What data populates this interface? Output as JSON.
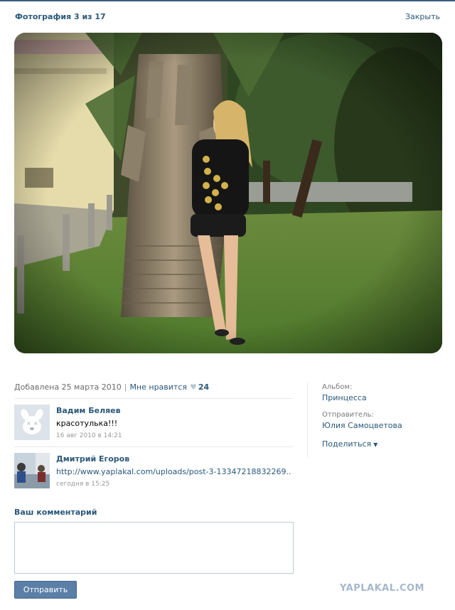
{
  "header": {
    "photo_title": "Фотография 3 из 17",
    "close_label": "Закрыть"
  },
  "photo": {
    "description": ""
  },
  "meta": {
    "added": "Добавлена 25 марта 2010",
    "separator": "|",
    "like_label": "Мне нравится",
    "like_count": "24"
  },
  "comments": [
    {
      "author": "Вадим Беляев",
      "text": "красотулька!!!",
      "date": "16 авг 2010 в 14:21",
      "avatar": "default-dog-avatar"
    },
    {
      "author": "Дмитрий Егоров",
      "text": "http://www.yaplakal.com/uploads/post-3-13347218832269..",
      "date": "сегодня в 15:25",
      "avatar": "user-photo-avatar"
    }
  ],
  "sidebar": {
    "album_label": "Альбом:",
    "album_value": "Принцесса",
    "sender_label": "Отправитель:",
    "sender_value": "Юлия Самоцветова",
    "share_label": "Поделиться"
  },
  "comment_form": {
    "label": "Ваш комментарий",
    "placeholder": "",
    "send_label": "Отправить"
  },
  "watermark": "YAPLAKAL.COM",
  "colors": {
    "link": "#2b587a",
    "button": "#5b7fa6",
    "topbar": "#3b5c80"
  }
}
